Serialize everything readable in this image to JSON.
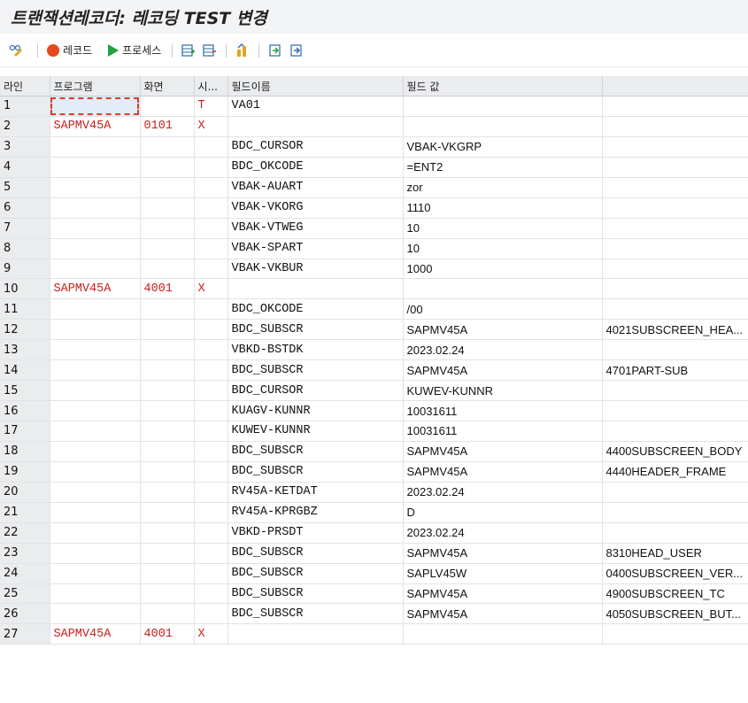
{
  "title": "트랜잭션레코더: 레코딩 TEST 변경",
  "toolbar": {
    "record_label": "레코드",
    "process_label": "프로세스"
  },
  "columns": {
    "line": "라인",
    "program": "프로그램",
    "screen": "화면",
    "start": "시...",
    "field_name": "필드이름",
    "field_value": "필드 값"
  },
  "rows": [
    {
      "line": "1",
      "program": "",
      "screen": "",
      "start": "T",
      "field": "VA01",
      "value": "",
      "extra": ""
    },
    {
      "line": "2",
      "program": "SAPMV45A",
      "screen": "0101",
      "start": "X",
      "field": "",
      "value": "",
      "extra": ""
    },
    {
      "line": "3",
      "program": "",
      "screen": "",
      "start": "",
      "field": "BDC_CURSOR",
      "value": "VBAK-VKGRP",
      "extra": ""
    },
    {
      "line": "4",
      "program": "",
      "screen": "",
      "start": "",
      "field": "BDC_OKCODE",
      "value": "=ENT2",
      "extra": ""
    },
    {
      "line": "5",
      "program": "",
      "screen": "",
      "start": "",
      "field": "VBAK-AUART",
      "value": "zor",
      "extra": ""
    },
    {
      "line": "6",
      "program": "",
      "screen": "",
      "start": "",
      "field": "VBAK-VKORG",
      "value": "1110",
      "extra": ""
    },
    {
      "line": "7",
      "program": "",
      "screen": "",
      "start": "",
      "field": "VBAK-VTWEG",
      "value": "10",
      "extra": ""
    },
    {
      "line": "8",
      "program": "",
      "screen": "",
      "start": "",
      "field": "VBAK-SPART",
      "value": "10",
      "extra": ""
    },
    {
      "line": "9",
      "program": "",
      "screen": "",
      "start": "",
      "field": "VBAK-VKBUR",
      "value": "1000",
      "extra": ""
    },
    {
      "line": "10",
      "program": "SAPMV45A",
      "screen": "4001",
      "start": "X",
      "field": "",
      "value": "",
      "extra": ""
    },
    {
      "line": "11",
      "program": "",
      "screen": "",
      "start": "",
      "field": "BDC_OKCODE",
      "value": "/00",
      "extra": ""
    },
    {
      "line": "12",
      "program": "",
      "screen": "",
      "start": "",
      "field": "BDC_SUBSCR",
      "value": "SAPMV45A",
      "extra": "4021SUBSCREEN_HEA..."
    },
    {
      "line": "13",
      "program": "",
      "screen": "",
      "start": "",
      "field": "VBKD-BSTDK",
      "value": "2023.02.24",
      "extra": ""
    },
    {
      "line": "14",
      "program": "",
      "screen": "",
      "start": "",
      "field": "BDC_SUBSCR",
      "value": "SAPMV45A",
      "extra": "4701PART-SUB"
    },
    {
      "line": "15",
      "program": "",
      "screen": "",
      "start": "",
      "field": "BDC_CURSOR",
      "value": "KUWEV-KUNNR",
      "extra": ""
    },
    {
      "line": "16",
      "program": "",
      "screen": "",
      "start": "",
      "field": "KUAGV-KUNNR",
      "value": "10031611",
      "extra": ""
    },
    {
      "line": "17",
      "program": "",
      "screen": "",
      "start": "",
      "field": "KUWEV-KUNNR",
      "value": "10031611",
      "extra": ""
    },
    {
      "line": "18",
      "program": "",
      "screen": "",
      "start": "",
      "field": "BDC_SUBSCR",
      "value": "SAPMV45A",
      "extra": "4400SUBSCREEN_BODY"
    },
    {
      "line": "19",
      "program": "",
      "screen": "",
      "start": "",
      "field": "BDC_SUBSCR",
      "value": "SAPMV45A",
      "extra": "4440HEADER_FRAME"
    },
    {
      "line": "20",
      "program": "",
      "screen": "",
      "start": "",
      "field": "RV45A-KETDAT",
      "value": "2023.02.24",
      "extra": ""
    },
    {
      "line": "21",
      "program": "",
      "screen": "",
      "start": "",
      "field": "RV45A-KPRGBZ",
      "value": "D",
      "extra": ""
    },
    {
      "line": "22",
      "program": "",
      "screen": "",
      "start": "",
      "field": "VBKD-PRSDT",
      "value": "2023.02.24",
      "extra": ""
    },
    {
      "line": "23",
      "program": "",
      "screen": "",
      "start": "",
      "field": "BDC_SUBSCR",
      "value": "SAPMV45A",
      "extra": "8310HEAD_USER"
    },
    {
      "line": "24",
      "program": "",
      "screen": "",
      "start": "",
      "field": "BDC_SUBSCR",
      "value": "SAPLV45W",
      "extra": "0400SUBSCREEN_VER..."
    },
    {
      "line": "25",
      "program": "",
      "screen": "",
      "start": "",
      "field": "BDC_SUBSCR",
      "value": "SAPMV45A",
      "extra": "4900SUBSCREEN_TC"
    },
    {
      "line": "26",
      "program": "",
      "screen": "",
      "start": "",
      "field": "BDC_SUBSCR",
      "value": "SAPMV45A",
      "extra": "4050SUBSCREEN_BUT..."
    },
    {
      "line": "27",
      "program": "SAPMV45A",
      "screen": "4001",
      "start": "X",
      "field": "",
      "value": "",
      "extra": ""
    }
  ]
}
